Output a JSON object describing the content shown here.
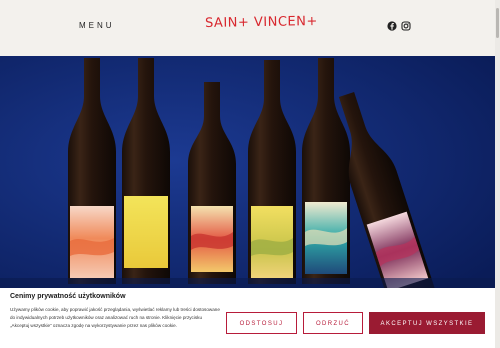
{
  "header": {
    "menu_label": "MENU",
    "logo_text": "SAIN+ VINCEN+",
    "social_icons": [
      "facebook-icon",
      "instagram-icon"
    ]
  },
  "hero": {
    "background_color": "#0f2670",
    "bottles": [
      {
        "label_theme": "orange-sunset"
      },
      {
        "label_theme": "yellow"
      },
      {
        "label_theme": "red-waves"
      },
      {
        "label_theme": "yellow-hills"
      },
      {
        "label_theme": "teal-waves"
      },
      {
        "label_theme": "pink-dusk"
      }
    ]
  },
  "cookie_banner": {
    "title": "Cenimy prywatność użytkowników",
    "text": "Używamy plików cookie, aby poprawić jakość przeglądania, wyświetlać reklamy lub treści dostosowane do indywidualnych potrzeb użytkowników oraz analizować ruch na stronie. Kliknięcie przycisku „Akceptuj wszystkie” oznacza zgodę na wykorzystywanie przez nas plików cookie.",
    "buttons": {
      "reject": "ODSTOSUJ",
      "customize": "ODRZUĆ",
      "accept": "AKCEPTUJ WSZYSTKIE"
    },
    "accent_color": "#9a1b32"
  }
}
